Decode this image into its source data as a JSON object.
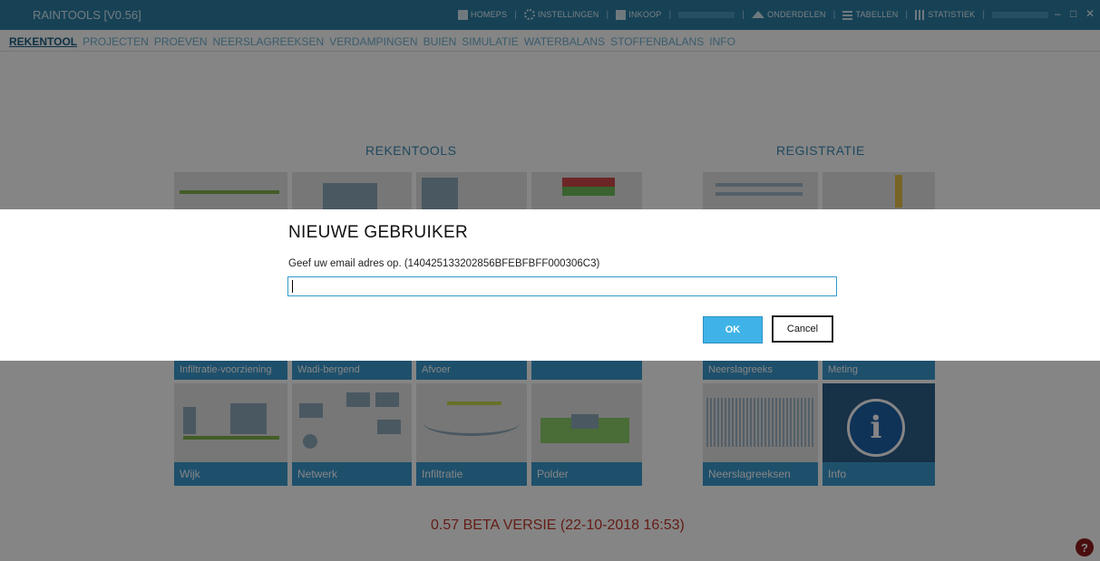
{
  "window": {
    "title": "RAINTOOLS [V0.56]",
    "menu": {
      "nodes": "HOMEPS",
      "settings": "INSTELLINGEN",
      "book": "INKOOP",
      "guides": "ONDERDELEN",
      "tables": "TABELLEN",
      "stats": "STATISTIEK"
    },
    "controls": {
      "minimize": "–",
      "maximize": "□",
      "close": "✕"
    }
  },
  "nav": {
    "items": [
      "REKENTOOL",
      "PROJECTEN",
      "PROEVEN",
      "NEERSLAGREEKSEN",
      "VERDAMPINGEN",
      "BUIEN",
      "SIMULATIE",
      "WATERBALANS",
      "STOFFENBALANS",
      "INFO"
    ],
    "active": "REKENTOOL"
  },
  "background": {
    "rekentools_heading": "REKENTOOLS",
    "registratie_heading": "REGISTRATIE",
    "tiles_row2": [
      "Infiltratie-voorziening",
      "Wadi-bergend",
      "Afvoer"
    ],
    "tiles_row3": [
      "Wijk",
      "Netwerk",
      "Infiltratie",
      "Polder"
    ],
    "registratie_row2": [
      "Neerslagreeks",
      "Meting"
    ],
    "registratie_row3": [
      "Neerslagreeksen",
      "Info"
    ],
    "info_glyph": "i",
    "version_text": "0.57 BETA VERSIE (22-10-2018 16:53)",
    "help_glyph": "?"
  },
  "dialog": {
    "title": "NIEUWE GEBRUIKER",
    "prompt": "Geef uw email adres op. (140425133202856BFEBFBFF000306C3)",
    "input_value": "",
    "ok_label": "OK",
    "cancel_label": "Cancel"
  },
  "colors": {
    "titlebar": "#2d7fa6",
    "nav_text": "#6fb0cf",
    "tile_caption": "#3a9ad0",
    "ok_button": "#3fb3e8",
    "version_text": "#c0392b"
  }
}
